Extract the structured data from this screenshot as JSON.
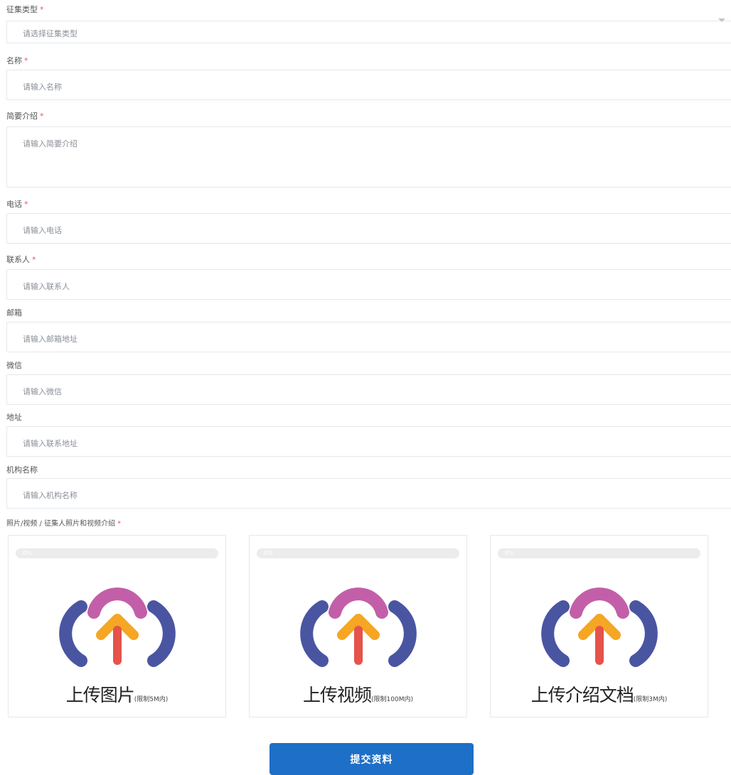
{
  "form": {
    "type_label": "征集类型",
    "type_placeholder": "请选择征集类型",
    "name_label": "名称",
    "name_placeholder": "请输入名称",
    "intro_label": "简要介绍",
    "intro_placeholder": "请输入简要介绍",
    "phone_label": "电话",
    "phone_placeholder": "请输入电话",
    "contact_label": "联系人",
    "contact_placeholder": "请输入联系人",
    "email_label": "邮箱",
    "email_placeholder": "请输入邮箱地址",
    "wechat_label": "微信",
    "wechat_placeholder": "请输入微信",
    "address_label": "地址",
    "address_placeholder": "请输入联系地址",
    "org_label": "机构名称",
    "org_placeholder": "请输入机构名称",
    "media_label": "照片/视频 / 征集人照片和视频介绍",
    "required_mark": "*"
  },
  "uploads": [
    {
      "progress_text": "0%",
      "title": "上传图片",
      "limit": "(限制5M内)"
    },
    {
      "progress_text": "0%",
      "title": "上传视频",
      "limit": "(限制100M内)"
    },
    {
      "progress_text": "0%",
      "title": "上传介绍文档",
      "limit": "(限制3M内)"
    }
  ],
  "submit_label": "提交资料",
  "colors": {
    "primary": "#1e6fc8",
    "required": "#ee5555",
    "cloud_left": "#4a55a2",
    "cloud_top": "#c25fa8",
    "arrow_head": "#f5a623",
    "arrow_stem": "#e5534b"
  }
}
